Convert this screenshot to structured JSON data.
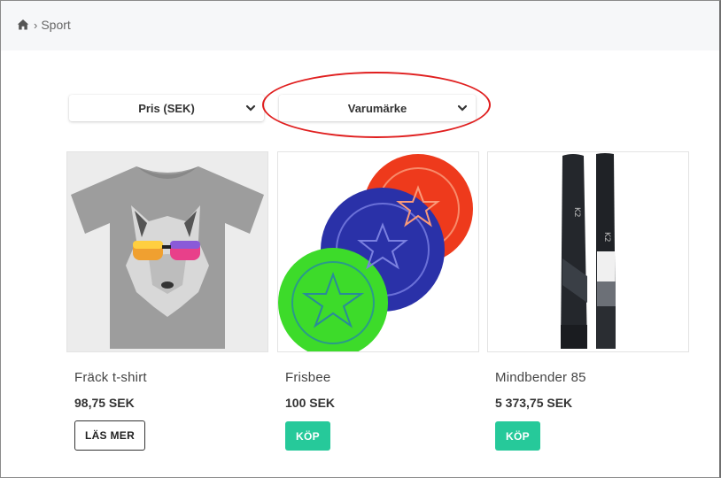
{
  "breadcrumb": {
    "home_icon": "home-icon",
    "separator": "›",
    "current": "Sport"
  },
  "filters": [
    {
      "label": "Pris (SEK)",
      "icon": "chevron-down-icon"
    },
    {
      "label": "Varumärke",
      "icon": "chevron-down-icon"
    }
  ],
  "highlight_color": "#e01f1f",
  "products": [
    {
      "name": "Fräck t-shirt",
      "price": "98,75 SEK",
      "button": "LÄS MER",
      "image": "wolf-tshirt-image"
    },
    {
      "name": "Frisbee",
      "price": "100 SEK",
      "button": "KÖP",
      "image": "frisbee-image"
    },
    {
      "name": "Mindbender 85",
      "price": "5 373,75 SEK",
      "button": "KÖP",
      "image": "ski-image"
    }
  ],
  "colors": {
    "buy_button": "#26c99a",
    "topbar": "#f6f7f9"
  }
}
